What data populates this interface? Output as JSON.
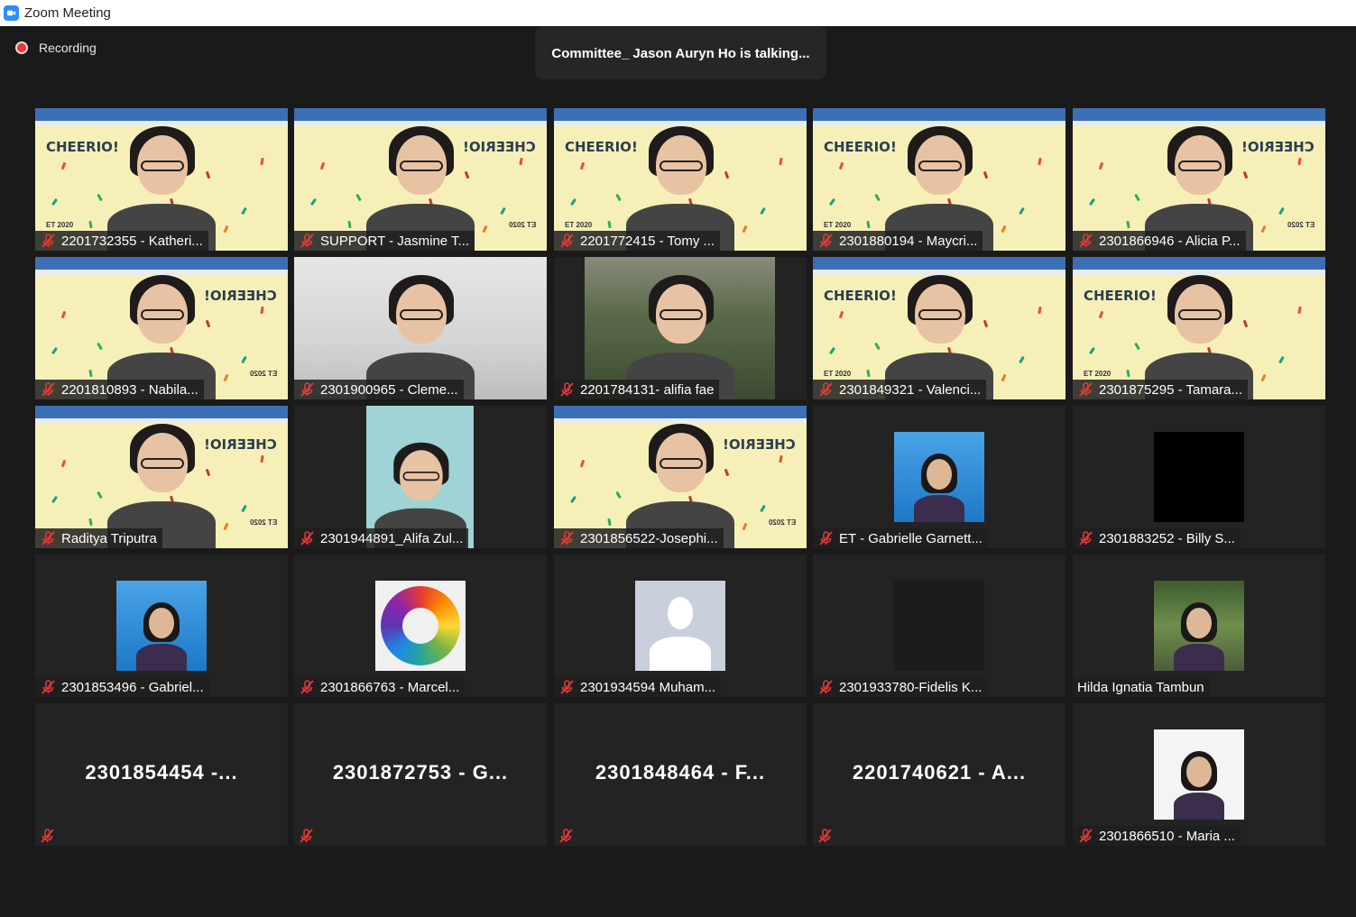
{
  "window": {
    "title": "Zoom Meeting"
  },
  "recording": {
    "label": "Recording"
  },
  "active_speaker": {
    "text": "Committee_ Jason Auryn Ho is talking..."
  },
  "participants": [
    {
      "name": "2201732355 - Katheri...",
      "muted": true,
      "video": "cheerio-left"
    },
    {
      "name": "SUPPORT - Jasmine T...",
      "muted": true,
      "video": "cheerio-right"
    },
    {
      "name": "2201772415 - Tomy ...",
      "muted": true,
      "video": "cheerio-left"
    },
    {
      "name": "2301880194 - Maycri...",
      "muted": true,
      "video": "cheerio-left"
    },
    {
      "name": "2301866946 - Alicia P...",
      "muted": true,
      "video": "cheerio-right"
    },
    {
      "name": "2201810893 - Nabila...",
      "muted": true,
      "video": "cheerio-right"
    },
    {
      "name": "2301900965 - Cleme...",
      "muted": true,
      "video": "room"
    },
    {
      "name": "2201784131- alifia fae",
      "muted": true,
      "video": "outdoor"
    },
    {
      "name": "2301849321 - Valenci...",
      "muted": true,
      "video": "cheerio-left"
    },
    {
      "name": "2301875295 - Tamara...",
      "muted": true,
      "video": "cheerio-left"
    },
    {
      "name": "Raditya Triputra",
      "muted": true,
      "video": "cheerio-right"
    },
    {
      "name": "2301944891_Alifa Zul...",
      "muted": true,
      "video": "portrait"
    },
    {
      "name": "2301856522-Josephi...",
      "muted": true,
      "video": "cheerio-right"
    },
    {
      "name": "ET - Gabrielle Garnett...",
      "muted": true,
      "video": "avatar-blue"
    },
    {
      "name": "2301883252 - Billy S...",
      "muted": true,
      "video": "avatar-black"
    },
    {
      "name": "2301853496 - Gabriel...",
      "muted": true,
      "video": "avatar-blue"
    },
    {
      "name": "2301866763 - Marcel...",
      "muted": true,
      "video": "avatar-colorwheel"
    },
    {
      "name": "2301934594 Muham...",
      "muted": true,
      "video": "avatar-default"
    },
    {
      "name": "2301933780-Fidelis K...",
      "muted": true,
      "video": "avatar-dark"
    },
    {
      "name": "Hilda Ignatia Tambun",
      "muted": false,
      "video": "avatar-garden"
    },
    {
      "name": "2301854454 -...",
      "muted": true,
      "video": "off"
    },
    {
      "name": "2301872753 - G...",
      "muted": true,
      "video": "off"
    },
    {
      "name": "2301848464 - F...",
      "muted": true,
      "video": "off"
    },
    {
      "name": "2201740621 - A...",
      "muted": true,
      "video": "off"
    },
    {
      "name": "2301866510 - Maria ...",
      "muted": true,
      "video": "avatar-light"
    }
  ],
  "cheerio": {
    "word": "CHEERIO!",
    "et": "ET 2020"
  },
  "colors": {
    "accent": "#2d8cff",
    "mute": "#e53935",
    "tile": "#232323",
    "background": "#1a1a1a"
  }
}
